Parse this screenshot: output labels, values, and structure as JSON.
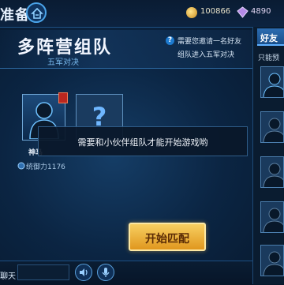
{
  "topbar": {
    "title": "准备",
    "home_icon": "home-icon",
    "gold": "100866",
    "gems": "4890"
  },
  "mode": {
    "title": "多阵营组队",
    "subtitle": "五军对决",
    "invite_line1": "需要您邀请一名好友",
    "invite_line2": "组队进入五军对决"
  },
  "player": {
    "name": "神马",
    "power_label": "统御力1176",
    "empty_slot_symbol": "?"
  },
  "toast": {
    "message": "需要和小伙伴组队才能开始游戏哟"
  },
  "start_button": {
    "label": "开始匹配"
  },
  "chat": {
    "label": "聊天"
  },
  "friends": {
    "tab_label": "好友",
    "filter_label": "只能预"
  },
  "colors": {
    "accent": "#4aa3e8",
    "start_button": "#f0b53c",
    "background": "#0b2543"
  }
}
